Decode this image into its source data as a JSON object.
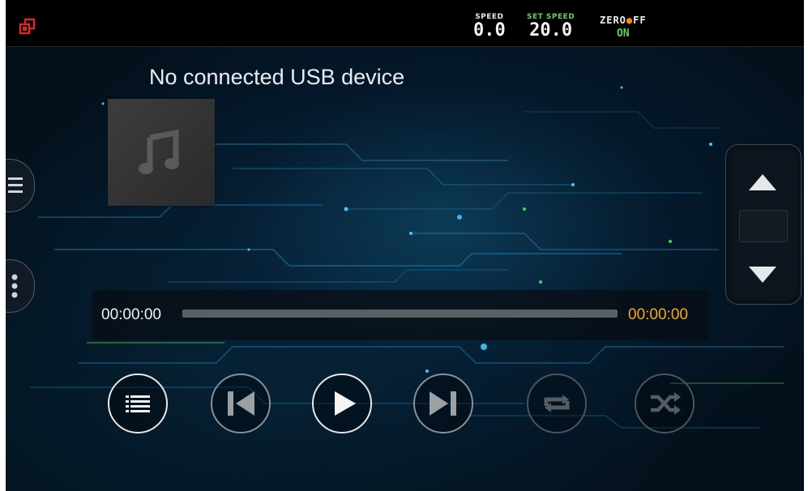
{
  "status_bar": {
    "speed_label": "SPEED",
    "speed_value": "0.0",
    "set_speed_label": "SET SPEED",
    "set_speed_value": "20.0",
    "zero_off_label_prefix": "ZERO",
    "zero_off_label_suffix": "FF",
    "zero_off_state": "ON"
  },
  "player": {
    "message": "No connected USB device",
    "current_time": "00:00:00",
    "total_time": "00:00:00",
    "progress": 0
  },
  "controls": {
    "playlist": "playlist-icon",
    "previous": "skip-previous-icon",
    "play": "play-icon",
    "next": "skip-next-icon",
    "repeat": "repeat-icon",
    "shuffle": "shuffle-icon"
  },
  "colors": {
    "accent_total_time": "#f2a928",
    "set_speed_label": "#5fd35f",
    "zero_off_on": "#5fd35f",
    "app_icon": "#e0262b"
  }
}
